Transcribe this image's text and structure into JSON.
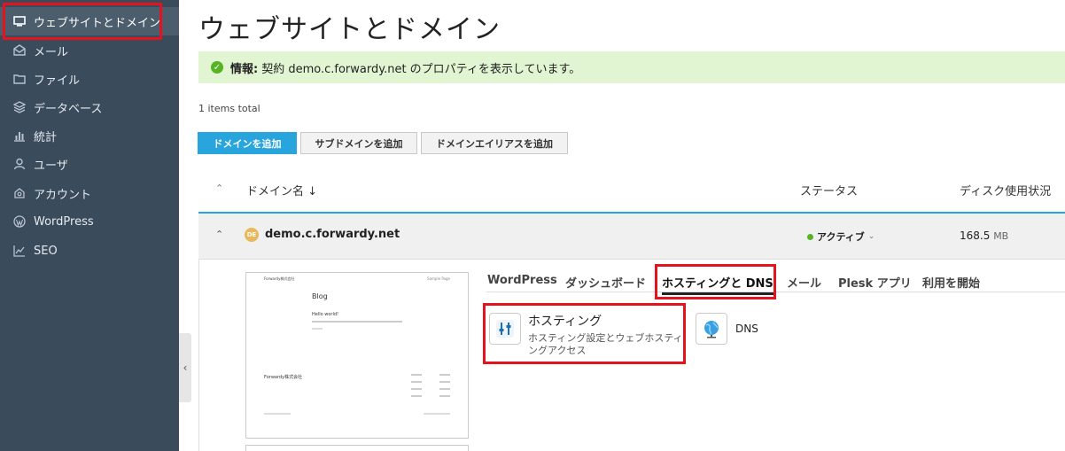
{
  "sidebar": {
    "items": [
      {
        "label": "ウェブサイトとドメイン",
        "icon": "monitor-icon"
      },
      {
        "label": "メール",
        "icon": "envelope-icon"
      },
      {
        "label": "ファイル",
        "icon": "folder-icon"
      },
      {
        "label": "データベース",
        "icon": "database-icon"
      },
      {
        "label": "統計",
        "icon": "bar-chart-icon"
      },
      {
        "label": "ユーザ",
        "icon": "user-icon"
      },
      {
        "label": "アカウント",
        "icon": "account-icon"
      },
      {
        "label": "WordPress",
        "icon": "wordpress-icon"
      },
      {
        "label": "SEO",
        "icon": "seo-chart-icon"
      }
    ]
  },
  "page": {
    "title": "ウェブサイトとドメイン"
  },
  "info": {
    "label": "情報:",
    "text": "契約 demo.c.forwardy.net のプロパティを表示しています。"
  },
  "list": {
    "items_total": "1 items total"
  },
  "toolbar": {
    "add_domain": "ドメインを追加",
    "add_subdomain": "サブドメインを追加",
    "add_alias": "ドメインエイリアスを追加"
  },
  "table": {
    "columns": {
      "domain": "ドメイン名 ↓",
      "status": "ステータス",
      "disk": "ディスク使用状況"
    },
    "row": {
      "logo_text": "DE",
      "domain": "demo.c.forwardy.net",
      "status": "アクティブ",
      "disk_value": "168.5",
      "disk_unit": "MB"
    }
  },
  "preview": {
    "brand": "Forwardy株式会社",
    "sample": "Sample Page",
    "blog": "Blog",
    "hello": "Hello world!",
    "footer_brand": "Forwardy株式会社"
  },
  "tabs": [
    {
      "label": "WordPress"
    },
    {
      "label": "ダッシュボード"
    },
    {
      "label": "ホスティングと DNS",
      "active": true
    },
    {
      "label": "メール"
    },
    {
      "label": "Plesk アプリ"
    },
    {
      "label": "利用を開始"
    }
  ],
  "hosting_tiles": {
    "hosting": {
      "title": "ホスティング",
      "desc_line1": "ホスティング設定とウェブホスティ",
      "desc_line2": "ングアクセス"
    },
    "dns": {
      "title": "DNS"
    }
  },
  "colors": {
    "sidebar_bg": "#3a4b5c",
    "primary": "#29a5de",
    "highlight": "#e3141e",
    "success": "#55b324",
    "info_bg": "#e2f5d3"
  }
}
